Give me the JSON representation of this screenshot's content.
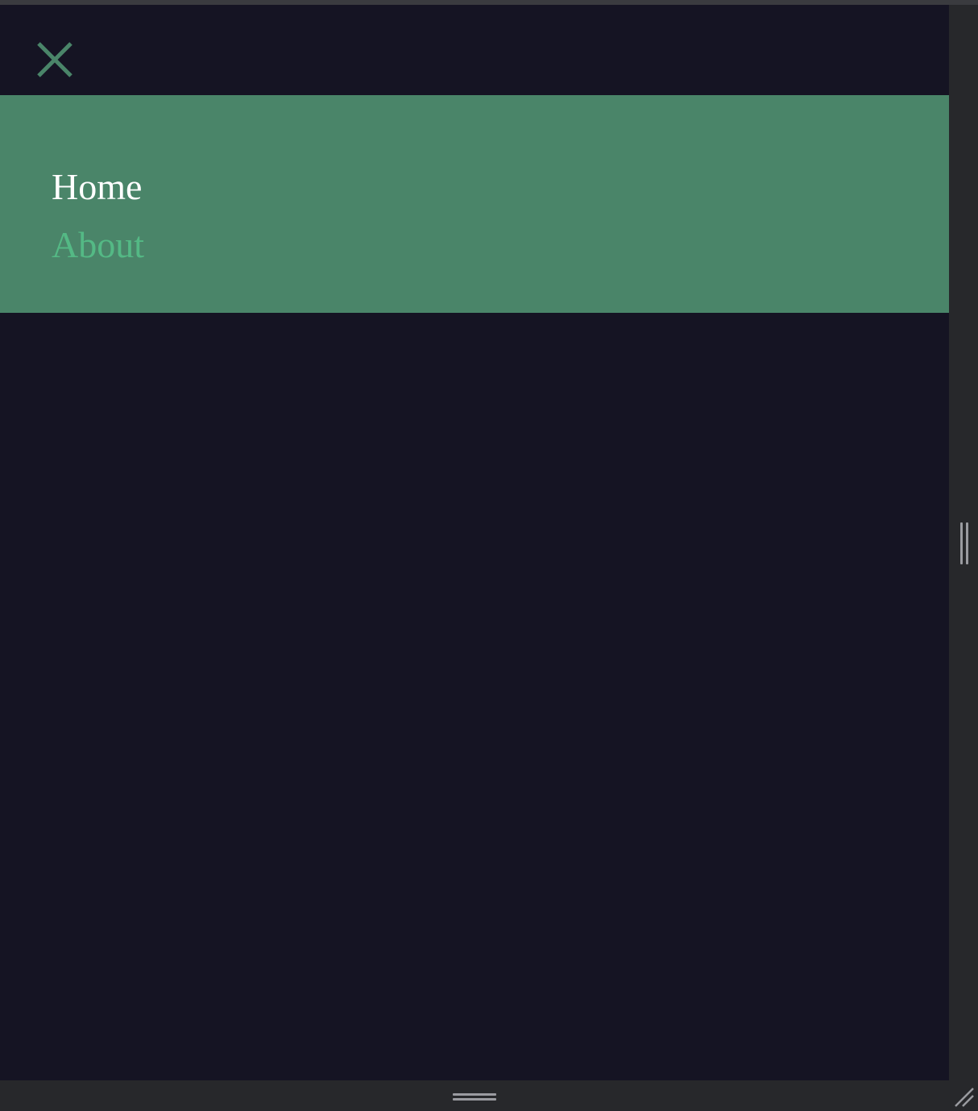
{
  "header": {
    "close_icon": "close-icon",
    "close_color": "#4a8569"
  },
  "nav": {
    "background": "#4a8569",
    "items": [
      {
        "label": "Home",
        "color": "#ffffff"
      },
      {
        "label": "About",
        "color": "#54b985"
      }
    ]
  },
  "frame": {
    "page_background": "#151423",
    "chrome_color": "#27282b",
    "grip_color": "#9a9ba0"
  }
}
